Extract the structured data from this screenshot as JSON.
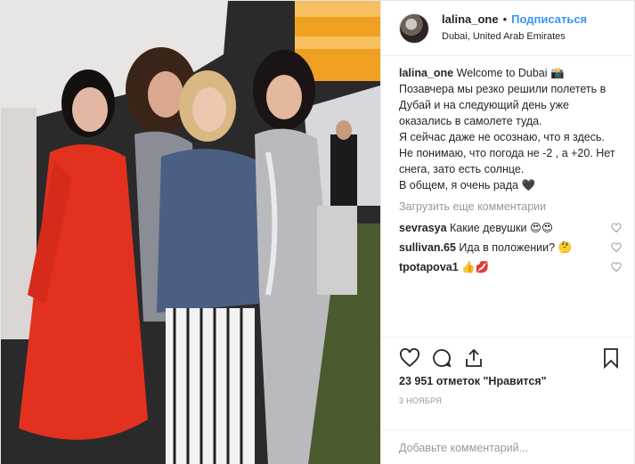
{
  "post": {
    "username": "lalina_one",
    "separator": "•",
    "follow_label": "Подписаться",
    "location": "Dubai, United Arab Emirates"
  },
  "caption": {
    "author": "lalina_one",
    "text": "Welcome to Dubai 📸\nПозавчера мы резко решили полететь в Дубай и на следующий день уже оказались в самолете туда.\nЯ сейчас даже не осознаю, что я здесь. Не понимаю, что погода не -2 , а +20. Нет снега, зато есть солнце.\nВ общем, я очень рада 🖤"
  },
  "load_more": "Загрузить еще комментарии",
  "comments": [
    {
      "user": "sevrasya",
      "text": "Какие девушки 😍😍"
    },
    {
      "user": "sullivan.65",
      "text": "Ида в положении? 🤔"
    },
    {
      "user": "tpotapova1",
      "text": "👍💋"
    }
  ],
  "actions": {
    "likes": "23 951 отметок \"Нравится\"",
    "date": "3 ноября"
  },
  "add_comment_placeholder": "Добавьте комментарий..."
}
